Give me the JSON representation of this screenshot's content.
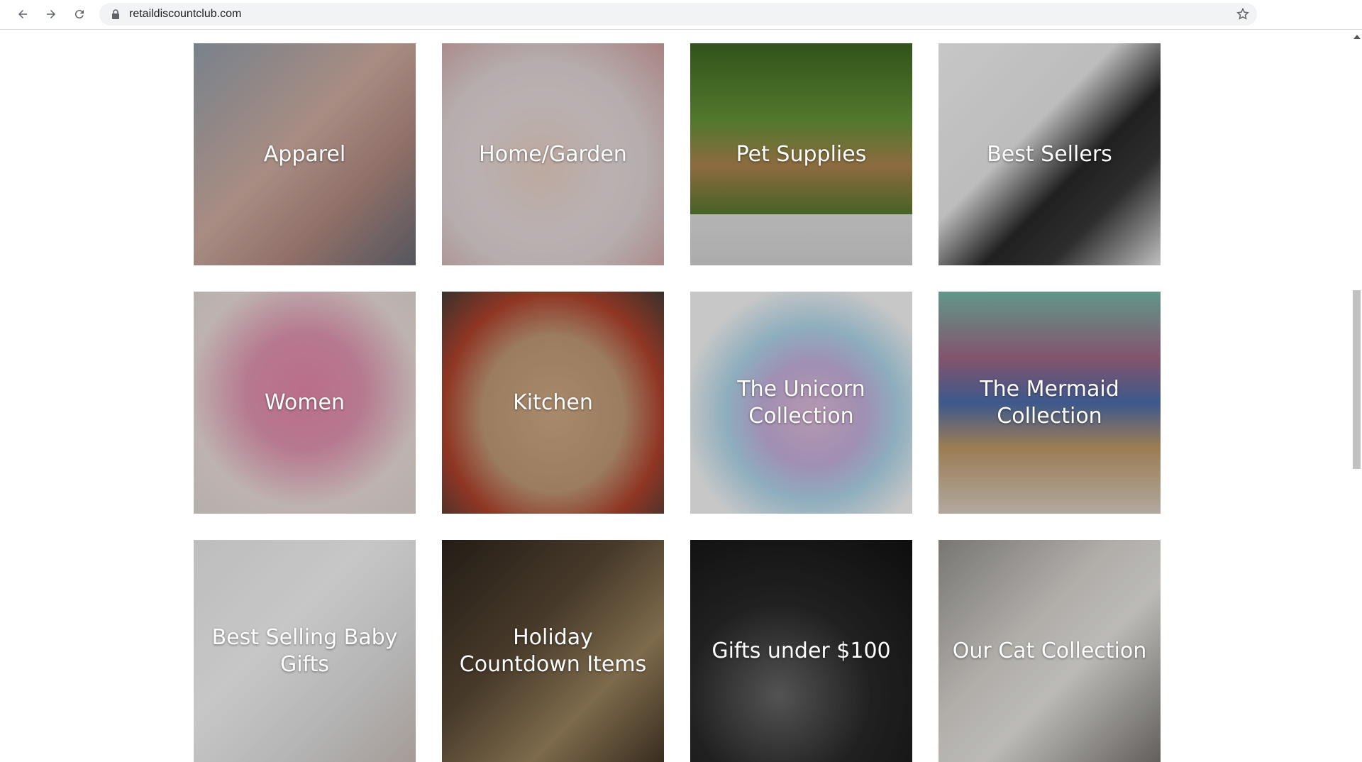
{
  "browser": {
    "url": "retaildiscountclub.com",
    "icons": [
      "back-arrow-icon",
      "forward-arrow-icon",
      "reload-icon",
      "lock-icon",
      "bookmark-star-icon"
    ]
  },
  "collections": [
    {
      "label": "Apparel",
      "colors": [
        "#b99a91",
        "#7a6b76"
      ]
    },
    {
      "label": "Home/Garden",
      "colors": [
        "#ece6e6",
        "#d66"
      ]
    },
    {
      "label": "Pet Supplies",
      "colors": [
        "#4f7d2e",
        "#c59a5a"
      ]
    },
    {
      "label": "Best Sellers",
      "colors": [
        "#f3f3f3",
        "#222222"
      ]
    },
    {
      "label": "Women",
      "colors": [
        "#f1e7e3",
        "#e88fac"
      ]
    },
    {
      "label": "Kitchen",
      "colors": [
        "#6c5a4e",
        "#c84a32"
      ]
    },
    {
      "label": "The Unicorn Collection",
      "colors": [
        "#ffffff",
        "#c9b3dc"
      ]
    },
    {
      "label": "The Mermaid Collection",
      "colors": [
        "#7fb5aa",
        "#d8c8b8"
      ]
    },
    {
      "label": "Best Selling Baby Gifts",
      "colors": [
        "#ffffff",
        "#d6d6d6"
      ]
    },
    {
      "label": "Holiday Countdown Items",
      "colors": [
        "#3a3125",
        "#8c7556"
      ]
    },
    {
      "label": "Gifts under $100",
      "colors": [
        "#1a1a1a",
        "#444444"
      ]
    },
    {
      "label": "Our Cat Collection",
      "colors": [
        "#e6e2de",
        "#8a8582"
      ]
    }
  ]
}
